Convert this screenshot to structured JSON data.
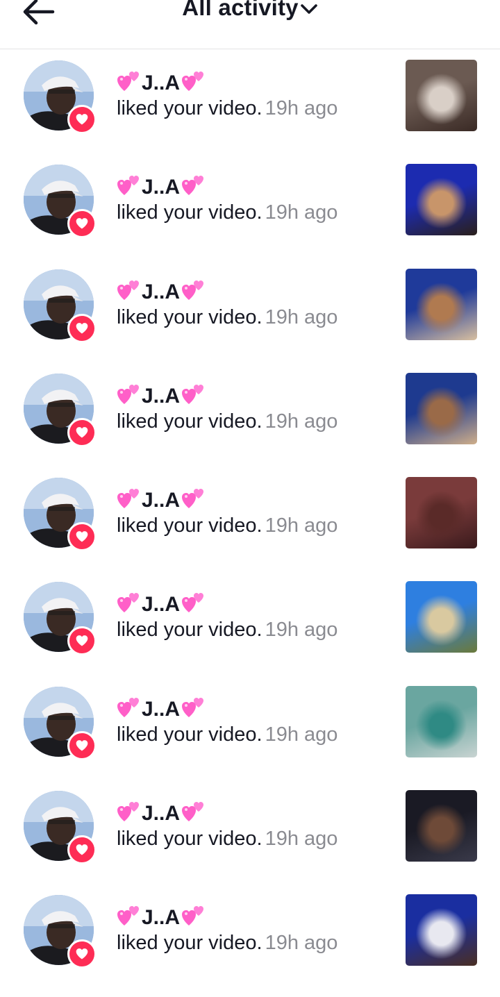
{
  "header": {
    "back_icon": "arrow-left-icon",
    "title": "All activity",
    "dropdown_icon": "chevron-down-icon"
  },
  "colors": {
    "like_badge": "#fe2c55",
    "time_text": "#8a8b91",
    "primary_text": "#161823",
    "divider": "#e3e3e4"
  },
  "notifications": [
    {
      "username": "J..A",
      "action": "liked your video.",
      "time": "19h ago",
      "thumb_colors": [
        "#6b5a52",
        "#d9cfc7",
        "#3a2a25"
      ]
    },
    {
      "username": "J..A",
      "action": "liked your video.",
      "time": "19h ago",
      "thumb_colors": [
        "#1c2bb0",
        "#c8956a",
        "#2a1f1a"
      ]
    },
    {
      "username": "J..A",
      "action": "liked your video.",
      "time": "19h ago",
      "thumb_colors": [
        "#1f3a9a",
        "#b07a50",
        "#d9c0a0"
      ]
    },
    {
      "username": "J..A",
      "action": "liked your video.",
      "time": "19h ago",
      "thumb_colors": [
        "#1e3a8f",
        "#9a6a48",
        "#cfae8a"
      ]
    },
    {
      "username": "J..A",
      "action": "liked your video.",
      "time": "19h ago",
      "thumb_colors": [
        "#7a3b3b",
        "#5a2a28",
        "#3a1a1c"
      ]
    },
    {
      "username": "J..A",
      "action": "liked your video.",
      "time": "19h ago",
      "thumb_colors": [
        "#2e7fe0",
        "#d9c9a0",
        "#6b7a3a"
      ]
    },
    {
      "username": "J..A",
      "action": "liked your video.",
      "time": "19h ago",
      "thumb_colors": [
        "#6aa6a0",
        "#2f8a84",
        "#c9d4d2"
      ]
    },
    {
      "username": "J..A",
      "action": "liked your video.",
      "time": "19h ago",
      "thumb_colors": [
        "#1a1a24",
        "#6e4a38",
        "#3a3a4a"
      ]
    },
    {
      "username": "J..A",
      "action": "liked your video.",
      "time": "19h ago",
      "thumb_colors": [
        "#1a2ea0",
        "#e8e8f0",
        "#4a2e22"
      ]
    }
  ]
}
